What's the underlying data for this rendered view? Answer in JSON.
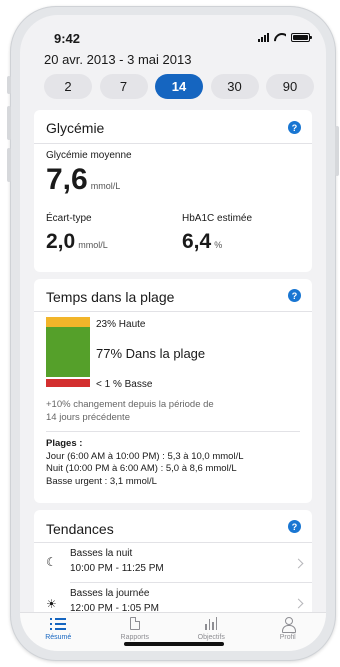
{
  "status_bar": {
    "time": "9:42"
  },
  "date_range": "20 avr. 2013 - 3 mai 2013",
  "period_chips": [
    "2",
    "7",
    "14",
    "30",
    "90"
  ],
  "selected_period": "14",
  "glycemia": {
    "title": "Glycémie",
    "help": "?",
    "average_label": "Glycémie moyenne",
    "average_value": "7,6",
    "average_unit": "mmol/L",
    "sd_label": "Écart-type",
    "sd_value": "2,0",
    "sd_unit": "mmol/L",
    "hba1c_label": "HbA1C estimée",
    "hba1c_value": "6,4",
    "hba1c_unit": "%"
  },
  "time_in_range": {
    "title": "Temps dans la plage",
    "help": "?",
    "high_pct": 23,
    "in_range_pct": 77,
    "low_pct": 1,
    "high_label": "23% Haute",
    "in_range_label": "77% Dans la plage",
    "low_label": "< 1 % Basse",
    "change_line1": "+10% changement depuis la période de",
    "change_line2": "14 jours précédente",
    "ranges_title": "Plages :",
    "range_day": "Jour (6:00 AM à 10:00 PM) : 5,3 à 10,0 mmol/L",
    "range_night": "Nuit (10:00 PM à 6:00 AM) : 5,0 à 8,6 mmol/L",
    "range_urgent_low": "Basse urgent : 3,1 mmol/L",
    "colors": {
      "high": "#f2b52a",
      "in_range": "#55a02a",
      "low": "#d32f2f"
    }
  },
  "trends": {
    "title": "Tendances",
    "help": "?",
    "items": [
      {
        "icon": "moon-icon",
        "title": "Basses la nuit",
        "subtitle": "10:00 PM - 11:25 PM"
      },
      {
        "icon": "sun-icon",
        "title": "Basses la journée",
        "subtitle": "12:00 PM - 1:05 PM"
      }
    ]
  },
  "tab_bar": {
    "tabs": [
      {
        "label": "Résumé",
        "icon": "list-icon",
        "active": true
      },
      {
        "label": "Rapports",
        "icon": "document-icon",
        "active": false
      },
      {
        "label": "Objectifs",
        "icon": "bar-chart-icon",
        "active": false
      },
      {
        "label": "Profil",
        "icon": "person-icon",
        "active": false
      }
    ]
  },
  "accent_color": "#1565c0"
}
